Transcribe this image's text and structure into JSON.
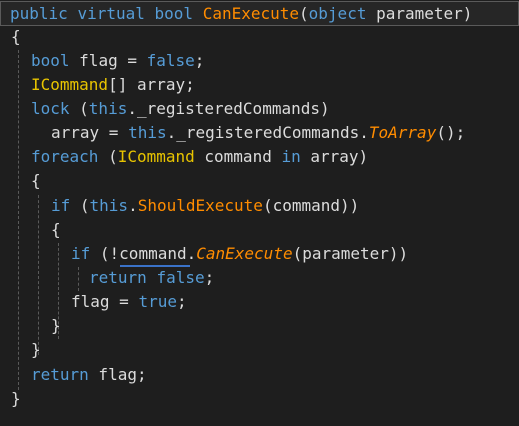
{
  "code": {
    "line1": {
      "public": "public",
      "virtual": "virtual",
      "bool": "bool",
      "name": "CanExecute",
      "open": "(",
      "object": "object",
      "param": "parameter",
      "close": ")"
    },
    "line2": {
      "text": "{"
    },
    "line3": {
      "bool": "bool",
      "rest": "flag = ",
      "false": "false",
      "end": ";"
    },
    "line4": {
      "type": "ICommand",
      "rest": "[] array;"
    },
    "line5": {
      "lock": "lock",
      "open": " (",
      "this": "this",
      "rest": "._registeredCommands)"
    },
    "line6": {
      "lhs": "array = ",
      "this": "this",
      "mid": "._registeredCommands.",
      "method": "ToArray",
      "end": "();"
    },
    "line7": {
      "foreach": "foreach",
      "open": " (",
      "type": "ICommand",
      "var": " command ",
      "in": "in",
      "rest": " array)"
    },
    "line8": {
      "text": "{"
    },
    "line9": {
      "if": "if",
      "open": " (",
      "this": "this",
      "dot": ".",
      "method": "ShouldExecute",
      "rest": "(command))"
    },
    "line10": {
      "text": "{"
    },
    "line11": {
      "if": "if",
      "open": " (!",
      "obj": "command",
      "dot": ".",
      "method": "CanExecute",
      "rest": "(parameter))"
    },
    "line12": {
      "return": "return",
      "false": "false",
      "end": ";"
    },
    "line13": {
      "lhs": "flag = ",
      "true": "true",
      "end": ";"
    },
    "line14": {
      "text": "}"
    },
    "line15": {
      "text": "}"
    },
    "line16": {
      "return": "return",
      "rest": " flag;"
    },
    "line17": {
      "text": "}"
    }
  },
  "colors": {
    "keyword": "#569cd6",
    "type": "#4ec9b0",
    "interface": "#e8c400",
    "method": "#ff8c00",
    "background": "#1e1e1e"
  }
}
